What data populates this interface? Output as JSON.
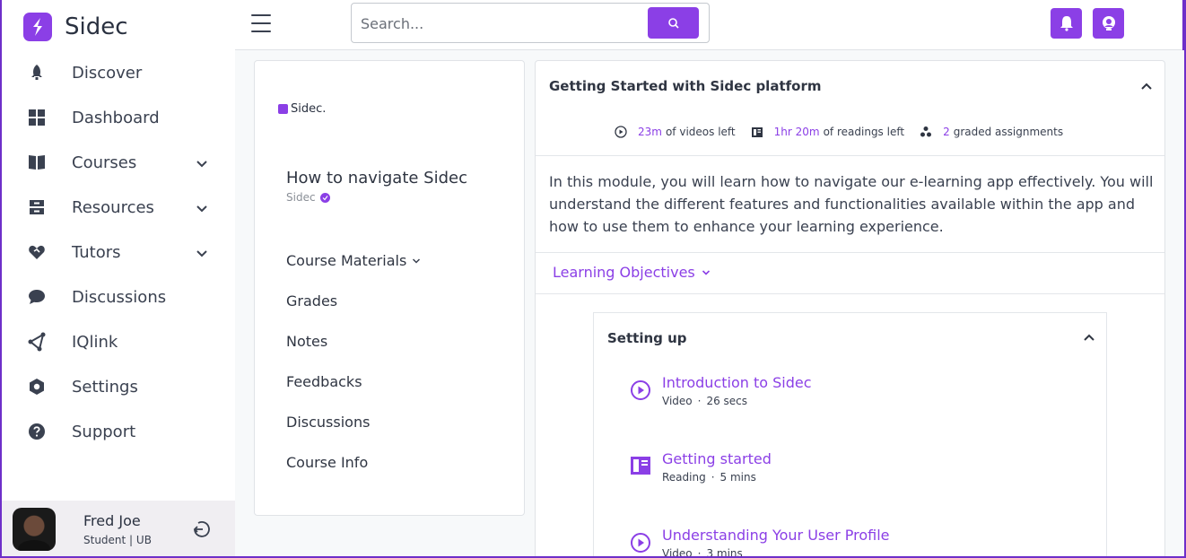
{
  "brand": {
    "name": "Sidec",
    "accent": "#8b3fe6"
  },
  "sidebar": {
    "items": [
      {
        "label": "Discover",
        "icon": "rocket-icon",
        "chevron": false
      },
      {
        "label": "Dashboard",
        "icon": "grid-icon",
        "chevron": false
      },
      {
        "label": "Courses",
        "icon": "book-icon",
        "chevron": true
      },
      {
        "label": "Resources",
        "icon": "archive-icon",
        "chevron": true
      },
      {
        "label": "Tutors",
        "icon": "heart-handshake-icon",
        "chevron": true
      },
      {
        "label": "Discussions",
        "icon": "chat-bubble-icon",
        "chevron": false
      },
      {
        "label": "IQlink",
        "icon": "share-nodes-icon",
        "chevron": false
      },
      {
        "label": "Settings",
        "icon": "gear-hex-icon",
        "chevron": false
      },
      {
        "label": "Support",
        "icon": "help-circle-icon",
        "chevron": false
      }
    ],
    "user": {
      "name": "Fred Joe",
      "role": "Student | UB"
    }
  },
  "topbar": {
    "search_placeholder": "Search..."
  },
  "course": {
    "brand_small": "Sidec.",
    "title": "How to navigate Sidec",
    "org": "Sidec",
    "menu": [
      {
        "label": "Course Materials",
        "dropdown": true
      },
      {
        "label": "Grades",
        "dropdown": false
      },
      {
        "label": "Notes",
        "dropdown": false
      },
      {
        "label": "Feedbacks",
        "dropdown": false
      },
      {
        "label": "Discussions",
        "dropdown": false
      },
      {
        "label": "Course Info",
        "dropdown": false
      }
    ]
  },
  "module": {
    "title": "Getting Started with Sidec platform",
    "stats": {
      "videos_value": "23m",
      "videos_label": "of videos left",
      "readings_value": "1hr 20m",
      "readings_label": "of readings left",
      "assignments_value": "2",
      "assignments_label": "graded assignments"
    },
    "description": "In this module, you will learn how to navigate our e-learning app effectively. You will understand the different features and functionalities available within the app and how to use them to enhance your learning experience.",
    "objectives_label": "Learning Objectives",
    "section": {
      "title": "Setting up",
      "lessons": [
        {
          "title": "Introduction to Sidec",
          "type": "Video",
          "duration": "26 secs",
          "icon": "play-circle-icon"
        },
        {
          "title": "Getting started",
          "type": "Reading",
          "duration": "5 mins",
          "icon": "reading-icon"
        },
        {
          "title": "Understanding Your User Profile",
          "type": "Video",
          "duration": "3 mins",
          "icon": "play-circle-icon"
        }
      ]
    }
  }
}
